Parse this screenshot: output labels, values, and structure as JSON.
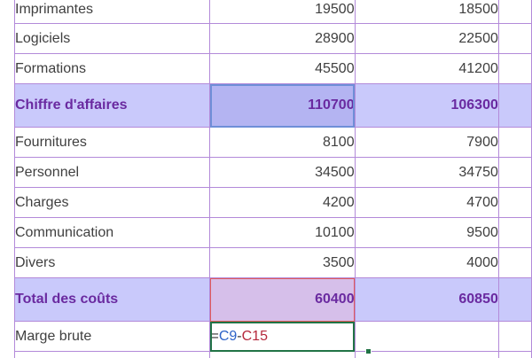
{
  "rows": [
    {
      "label": "Imprimantes",
      "v1": "19500",
      "v2": "18500"
    },
    {
      "label": "Logiciels",
      "v1": "28900",
      "v2": "22500"
    },
    {
      "label": "Formations",
      "v1": "45500",
      "v2": "41200"
    },
    {
      "label": "Chiffre d'affaires",
      "v1": "110700",
      "v2": "106300"
    },
    {
      "label": "Fournitures",
      "v1": "8100",
      "v2": "7900"
    },
    {
      "label": "Personnel",
      "v1": "34500",
      "v2": "34750"
    },
    {
      "label": "Charges",
      "v1": "4200",
      "v2": "4700"
    },
    {
      "label": "Communication",
      "v1": "10100",
      "v2": "9500"
    },
    {
      "label": "Divers",
      "v1": "3500",
      "v2": "4000"
    },
    {
      "label": "Total des coûts",
      "v1": "60400",
      "v2": "60850"
    },
    {
      "label": "Marge brute"
    }
  ],
  "formula": {
    "eq": "=",
    "ref1": "C9",
    "op": "-",
    "ref2": "C15"
  },
  "colors": {
    "grid_border": "#b38ad9",
    "summary_fill": "#c9c9fb",
    "summary_text": "#6a2aa0",
    "selection_blue": "#6f8fd8",
    "selection_red": "#e05b5b",
    "active_cell_border": "#217346"
  }
}
